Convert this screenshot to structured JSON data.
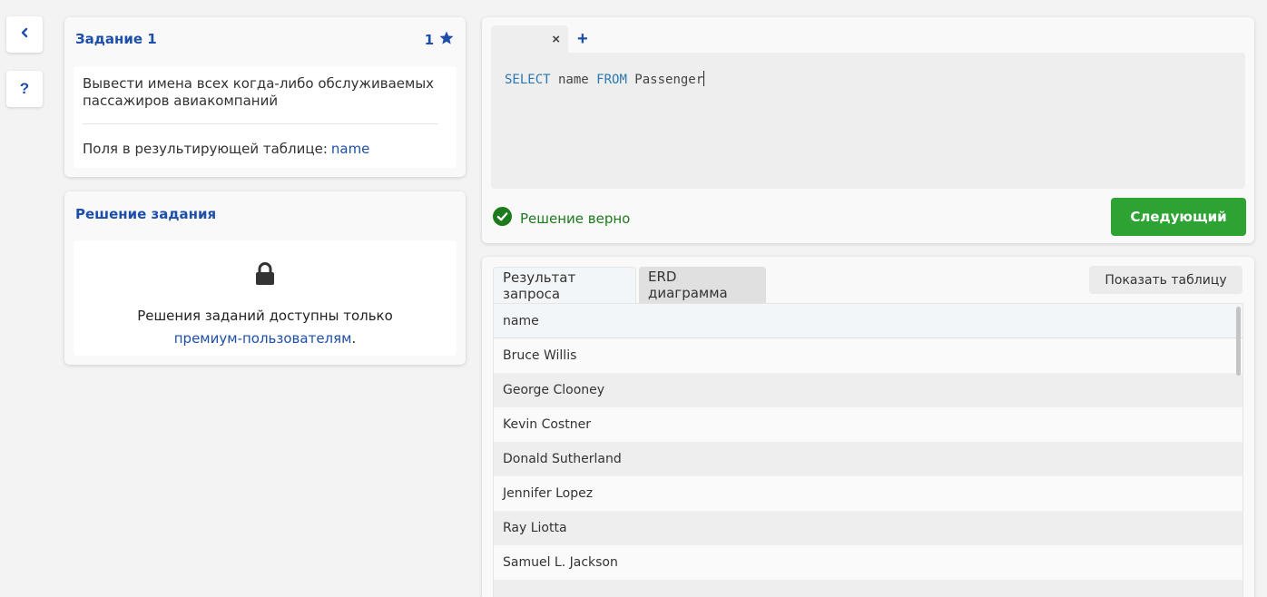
{
  "nav": {
    "back_icon": "chevron-left-icon",
    "help_label": "?"
  },
  "task": {
    "title": "Задание 1",
    "score": "1",
    "description": "Вывести имена всех когда-либо обслуживаемых пассажиров авиакомпаний",
    "fields_label": "Поля в результирующей таблице:",
    "fields_value": "name"
  },
  "solution": {
    "title": "Решение задания",
    "locked_text": "Решения заданий доступны только",
    "locked_link": "премиум-пользователям",
    "locked_suffix": "."
  },
  "editor": {
    "tab_close": "×",
    "tab_add": "+",
    "code": {
      "kw1": "SELECT",
      "t1": " name ",
      "kw2": "FROM",
      "t2": " Passenger"
    },
    "status": "Решение верно",
    "next_button": "Следующий"
  },
  "result": {
    "tabs": [
      "Результат запроса",
      "ERD диаграмма"
    ],
    "show_table_button": "Показать таблицу",
    "columns": [
      "name"
    ],
    "rows": [
      "Bruce Willis",
      "George Clooney",
      "Kevin Costner",
      "Donald Sutherland",
      "Jennifer Lopez",
      "Ray Liotta",
      "Samuel L. Jackson",
      ""
    ]
  },
  "colors": {
    "accent": "#1e4fa8",
    "success": "#2ca332",
    "success_text": "#1d7a1d"
  }
}
